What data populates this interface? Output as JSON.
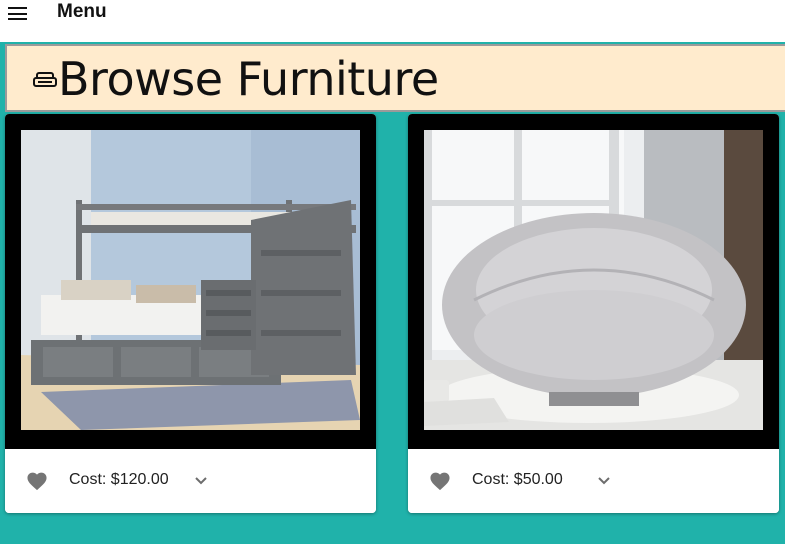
{
  "header": {
    "menu_label": "Menu",
    "menu_icon": "hamburger-menu-icon"
  },
  "banner": {
    "title": "Browse Furniture",
    "icon": "couch-icon",
    "background": "#ffebcd"
  },
  "page": {
    "background": "#20b2aa"
  },
  "products": [
    {
      "image": "bunk-bed-with-stairs",
      "cost_label": "Cost: $120.00",
      "favorite_icon": "heart-icon",
      "expand_icon": "chevron-down-icon"
    },
    {
      "image": "round-papasan-chair",
      "cost_label": "Cost: $50.00",
      "favorite_icon": "heart-icon",
      "expand_icon": "chevron-down-icon"
    }
  ]
}
